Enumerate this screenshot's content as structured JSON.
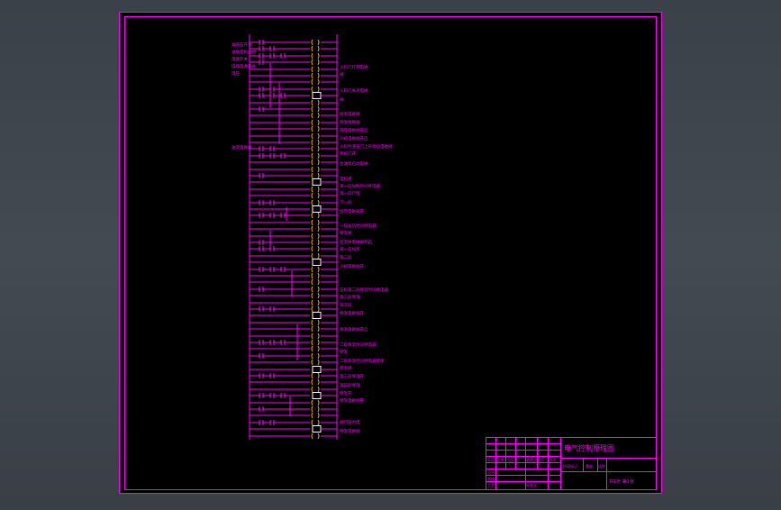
{
  "app": {
    "background": "#40464d",
    "sheet_color": "#000000",
    "line_color": "#ff00ff",
    "coil_color": "#ffaa00",
    "white_color": "#ffffff"
  },
  "drawing": {
    "left_labels": [
      "高低压开关",
      "油泵电机启动",
      "电源开关",
      "操作电源开关",
      "电压",
      "油温电磁阀",
      "主油泵电磁阀"
    ],
    "right_labels": [
      "入料门打开电磁",
      "阀",
      "入料门关闭电磁",
      "阀",
      "加温电磁阀",
      "保温电磁阀",
      "液压电磁阀开启",
      "冷却电磁阀开启",
      "入料时液压门上升到位电磁阀",
      "保护门开",
      "主油泵启动电磁",
      "电控柜",
      "第一段加料时间继电器",
      "第一段行程",
      "下一段",
      "加热电磁阀开",
      "一段加热时间继电器",
      "保温阀",
      "加温阀电磁阀开启",
      "第一段加热",
      "第二段",
      "冷却电磁阀开",
      "压料第二段保温时间继电器",
      "第三段保温",
      "第三段",
      "保温电磁阀开",
      "保温电磁阀开启",
      "二段保温时间继电器",
      "保温",
      "二段保温时间继电器结束",
      "保温阀",
      "第三段保温开",
      "第四段保温",
      "保温开",
      "保温电磁阀开",
      "阀门压力电",
      "保温电磁阀"
    ],
    "title_block": {
      "title": "电气控制原理图",
      "row_labels": [
        "标记",
        "处数",
        "分区",
        "更改文件号",
        "签名"
      ],
      "lower_labels": [
        "设计",
        "审核",
        "工艺",
        "标准化",
        "批准",
        "阶段标记",
        "重量",
        "比例"
      ],
      "footer": "共1张 第1张"
    }
  }
}
